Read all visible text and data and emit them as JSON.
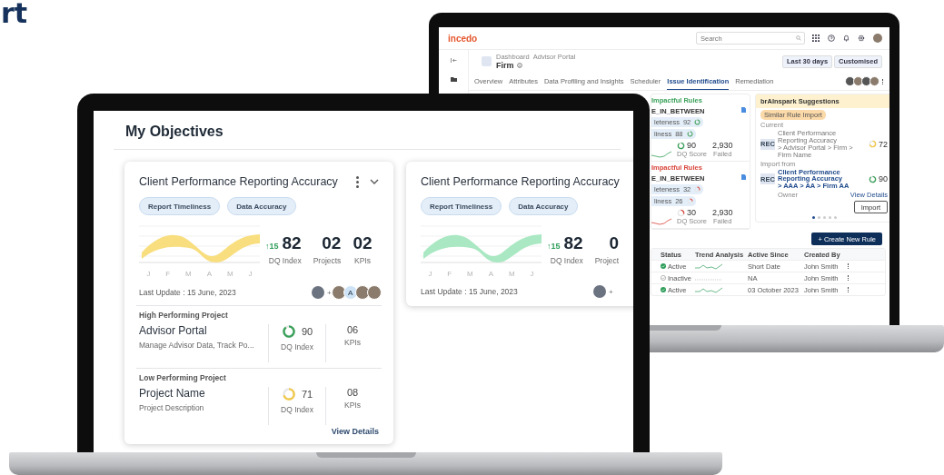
{
  "corner_text": "rt",
  "back_app": {
    "logo": "incedo",
    "search": {
      "placeholder": "Search"
    },
    "breadcrumb": [
      "Dashboard",
      "Advisor Portal"
    ],
    "page_title": "Firm",
    "date_range": "Last 30 days",
    "custom_range": "Customised",
    "tabs": [
      {
        "label": "Overview",
        "selected": false
      },
      {
        "label": "Attributes",
        "selected": false
      },
      {
        "label": "Data Profiling and Insights",
        "selected": false
      },
      {
        "label": "Scheduler",
        "selected": false
      },
      {
        "label": "Issue Identification",
        "selected": true
      },
      {
        "label": "Remediation",
        "selected": false
      }
    ],
    "rule_groups": [
      {
        "title": "Impactful Rules",
        "color": "#3aa15a",
        "rule": "E_IN_BETWEEN",
        "chips": [
          {
            "label": "leteness",
            "value": "92"
          },
          {
            "label": "liness",
            "value": "88"
          }
        ],
        "score": {
          "value": "90",
          "label": "DQ Score"
        },
        "failed": {
          "value": "2,930",
          "label": "Failed"
        }
      },
      {
        "title": "Impactful Rules",
        "color": "#d9443a",
        "rule": "E_IN_BETWEEN",
        "chips": [
          {
            "label": "leteness",
            "value": "32"
          },
          {
            "label": "liness",
            "value": "26"
          }
        ],
        "score": {
          "value": "30",
          "label": "DQ Score"
        },
        "failed": {
          "value": "2,930",
          "label": "Failed"
        }
      }
    ],
    "suggestions": {
      "title": "brAInspark Suggestions",
      "tag": "Similar Rule Import",
      "current_label": "Current",
      "import_label": "Import from",
      "items": [
        {
          "badge": "REC",
          "title": "Client Performance Reporting Accuracy",
          "path": "> Advisor Portal > Firm > Firm Name",
          "score": "72",
          "color": "#f2c94c",
          "selected": false
        },
        {
          "badge": "REC",
          "title": "Client Performance Reporting Accuracy",
          "path": "> AAA > AA > Firm AA",
          "score": "90",
          "color": "#3aa15a",
          "selected": true
        }
      ],
      "owner_label": "Owner",
      "view_details": "View Details",
      "import_button": "Import",
      "pages": [
        {
          "selected": true
        },
        {
          "selected": false
        },
        {
          "selected": false
        },
        {
          "selected": false
        },
        {
          "selected": false
        }
      ]
    },
    "create_button": "+ Create New Rule",
    "table": {
      "columns": [
        "Status",
        "Trend Analysis",
        "Active Since",
        "Created By"
      ],
      "rows": [
        {
          "status": "Active",
          "active": true,
          "active_since": "Short Date",
          "created_by": "John Smith"
        },
        {
          "status": "Inactive",
          "active": false,
          "active_since": "NA",
          "created_by": "John Smith"
        },
        {
          "status": "Active",
          "active": true,
          "active_since": "03 October 2023",
          "created_by": "John Smith"
        }
      ]
    }
  },
  "front_app": {
    "title": "My Objectives",
    "cards": [
      {
        "title": "Client Performance Reporting Accuracy",
        "menu": true,
        "tags": [
          "Report Timeliness",
          "Data Accuracy"
        ],
        "color": "#f8de7e",
        "months": [
          "J",
          "F",
          "M",
          "A",
          "M",
          "J"
        ],
        "trend": "↑15",
        "stats": [
          {
            "value": "82",
            "label": "DQ Index"
          },
          {
            "value": "02",
            "label": "Projects"
          },
          {
            "value": "02",
            "label": "KPIs"
          }
        ],
        "last_update": "Last Update : 15 June, 2023",
        "plus": "+",
        "members": [
          {
            "kind": "photo"
          },
          {
            "kind": "initial",
            "text": "A"
          },
          {
            "kind": "photo"
          },
          {
            "kind": "photo"
          }
        ],
        "projects": [
          {
            "heading": "High Performing Project",
            "name": "Advisor Portal",
            "description": "Manage Advisor Data, Track Po...",
            "score": "90",
            "color": "#3aa15a",
            "score_label": "DQ Index",
            "kpis": "06",
            "kpis_label": "KPIs"
          },
          {
            "heading": "Low Performing Project",
            "name": "Project Name",
            "description": "Project Description",
            "score": "71",
            "color": "#f2c94c",
            "score_label": "DQ Index",
            "kpis": "08",
            "kpis_label": "KPIs"
          }
        ],
        "view_details": "View Details"
      },
      {
        "title": "Client Performance Reporting Accuracy",
        "tags": [
          "Report Timeliness",
          "Data Accuracy"
        ],
        "color": "#a9e8c2",
        "months": [
          "J",
          "F",
          "M",
          "A",
          "M",
          "J"
        ],
        "trend": "↑15",
        "stats": [
          {
            "value": "82",
            "label": "DQ Index"
          },
          {
            "value": "0",
            "label": "Project"
          }
        ],
        "last_update": "Last Update : 15 June, 2023",
        "plus": "+"
      }
    ]
  }
}
